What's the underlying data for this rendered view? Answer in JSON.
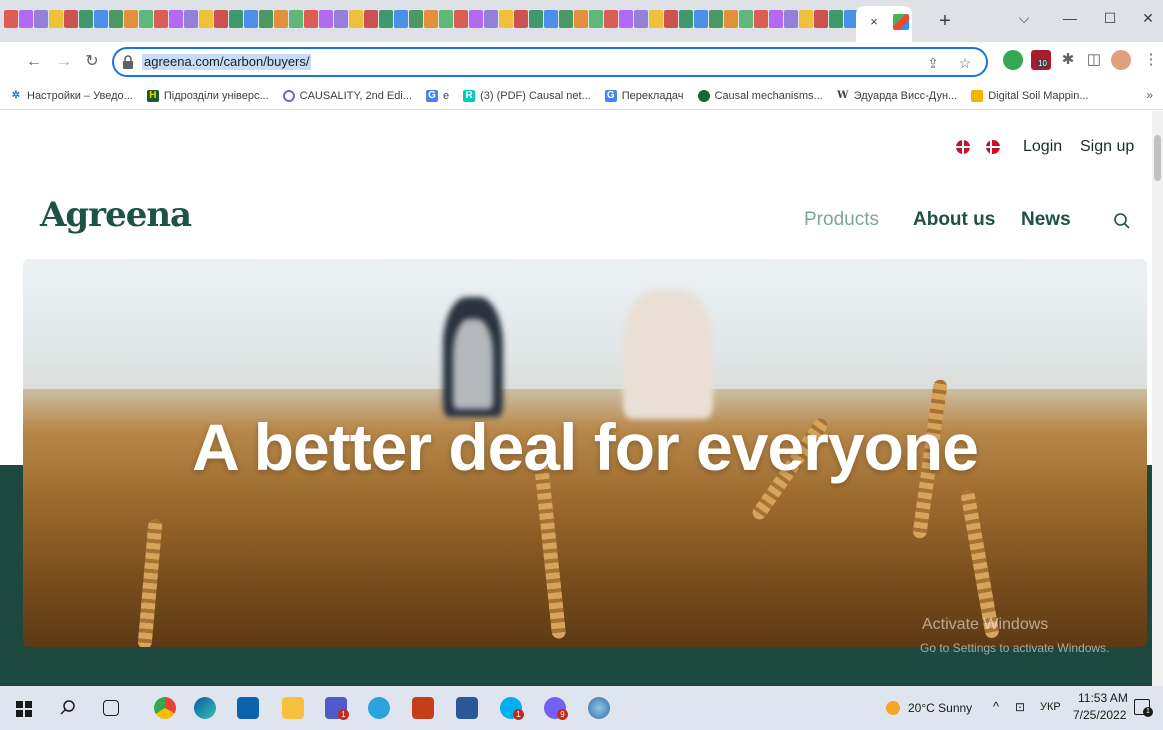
{
  "browser": {
    "url": "agreena.com/carbon/buyers/",
    "tab_close_glyph": "×",
    "new_tab_glyph": "+",
    "window_controls": [
      "⌵",
      "—",
      "☐",
      "✕"
    ],
    "bookmarks": [
      {
        "label": "Настройки – Уведо...",
        "icon": "gear-icon"
      },
      {
        "label": "Підрозділи універс...",
        "icon": "shield-icon"
      },
      {
        "label": "CAUSALITY, 2nd Edi...",
        "icon": "circle-icon"
      },
      {
        "label": "e",
        "icon": "translate-icon"
      },
      {
        "label": "(3) (PDF) Causal net...",
        "icon": "researchgate-icon"
      },
      {
        "label": "Перекладач",
        "icon": "translate-icon"
      },
      {
        "label": "Causal mechanisms...",
        "icon": "mechanism-icon"
      },
      {
        "label": "Эдуарда Висс-Дун...",
        "icon": "wikipedia-icon"
      },
      {
        "label": "Digital Soil Mappin...",
        "icon": "book-icon"
      }
    ],
    "bookmarks_more": "»",
    "extension_badge": "10"
  },
  "site": {
    "logo": "Agreena",
    "top_links": {
      "login": "Login",
      "signup": "Sign up"
    },
    "nav": {
      "products": "Products",
      "about": "About us",
      "news": "News"
    },
    "hero_title": "A better deal for everyone",
    "brand_color": "#1e5246",
    "band_color": "#1c4840"
  },
  "os": {
    "watermark_title": "Activate Windows",
    "watermark_sub": "Go to Settings to activate Windows.",
    "weather": "20°C  Sunny",
    "lang": "УКР",
    "time": "11:53 AM",
    "date": "7/25/2022",
    "badges": {
      "teams": "1",
      "skype": "1",
      "viber": "9",
      "notifications": "1"
    }
  }
}
